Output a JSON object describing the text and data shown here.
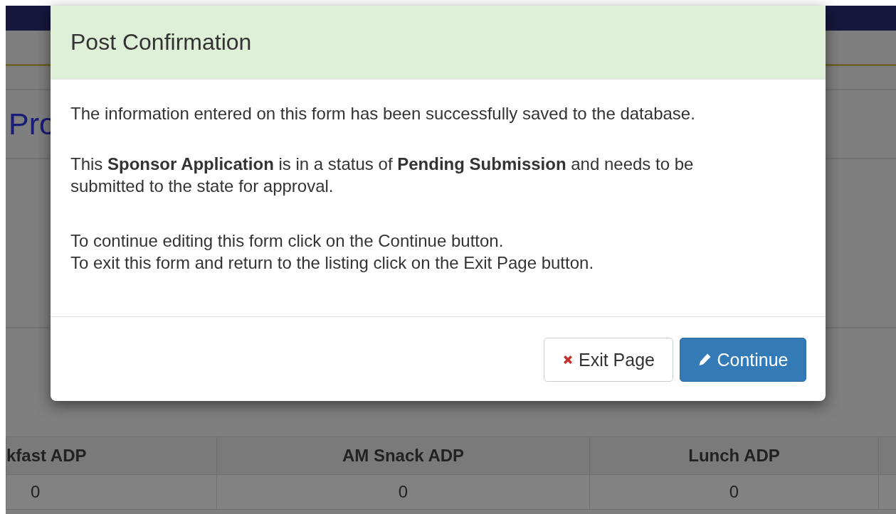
{
  "page": {
    "heading": "Pro",
    "table": {
      "columns": [
        "kfast ADP",
        "AM Snack ADP",
        "Lunch ADP"
      ],
      "rows": [
        [
          "0",
          "0",
          "0"
        ]
      ]
    }
  },
  "modal": {
    "title": "Post Confirmation",
    "paragraphs": [
      [
        "The information entered on this form has been successfully saved to the database."
      ],
      [
        "This **Sponsor Application** is in a status of **Pending Submission** and needs to be submitted to the state for approval."
      ],
      [
        "To continue editing this form click on the Continue button.",
        "To exit this form and return to the listing click on the Exit Page button."
      ]
    ],
    "buttons": [
      {
        "kind": "exit",
        "label": "Exit Page"
      },
      {
        "kind": "continue",
        "label": "Continue"
      }
    ]
  }
}
